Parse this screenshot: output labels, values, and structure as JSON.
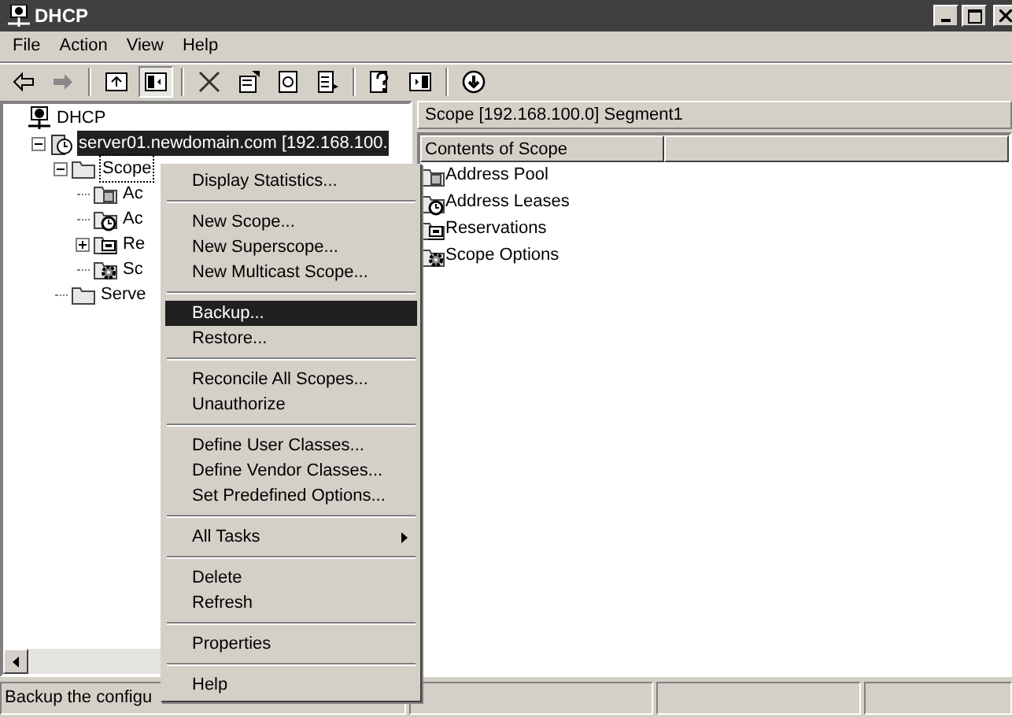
{
  "window": {
    "title": "DHCP"
  },
  "menu_bar": [
    "File",
    "Action",
    "View",
    "Help"
  ],
  "toolbar": [
    {
      "kind": "back",
      "disabled": false
    },
    {
      "kind": "forward",
      "disabled": true
    },
    {
      "kind": "sep"
    },
    {
      "kind": "up",
      "selected": false
    },
    {
      "kind": "tree",
      "selected": true
    },
    {
      "kind": "sep"
    },
    {
      "kind": "delete"
    },
    {
      "kind": "properties"
    },
    {
      "kind": "refresh"
    },
    {
      "kind": "export"
    },
    {
      "kind": "sep"
    },
    {
      "kind": "help"
    },
    {
      "kind": "pane"
    },
    {
      "kind": "sep"
    },
    {
      "kind": "download"
    }
  ],
  "tree": [
    {
      "label": "DHCP",
      "kind": "dhcp",
      "children": [
        {
          "label": "server01.newdomain.com [192.168.100.",
          "kind": "server",
          "expanded": true,
          "selected": true,
          "children": [
            {
              "label": "Scope",
              "kind": "folder",
              "expanded": true,
              "selected": false,
              "children": [
                {
                  "label": "Ac",
                  "kind": "pool",
                  "selected": false
                },
                {
                  "label": "Ac",
                  "kind": "leases",
                  "selected": false
                },
                {
                  "label": "Re",
                  "kind": "reservations",
                  "expanded": false,
                  "selected": false
                },
                {
                  "label": "Sc",
                  "kind": "options",
                  "selected": false
                }
              ]
            },
            {
              "label": "Serve",
              "kind": "folder",
              "selected": false
            }
          ]
        }
      ]
    }
  ],
  "right_pane": {
    "title": "Scope [192.168.100.0] Segment1",
    "columns": [
      "Contents of Scope"
    ],
    "items": [
      {
        "label": "Address Pool",
        "kind": "pool"
      },
      {
        "label": "Address Leases",
        "kind": "leases"
      },
      {
        "label": "Reservations",
        "kind": "reservations"
      },
      {
        "label": "Scope Options",
        "kind": "options"
      }
    ]
  },
  "status_bar": {
    "text": "Backup the configu"
  },
  "context_menu": [
    [
      {
        "label": "Display Statistics...",
        "selected": false
      }
    ],
    [
      {
        "label": "New Scope...",
        "selected": false
      },
      {
        "label": "New Superscope...",
        "selected": false
      },
      {
        "label": "New Multicast Scope...",
        "selected": false
      }
    ],
    [
      {
        "label": "Backup...",
        "selected": true
      },
      {
        "label": "Restore...",
        "selected": false
      }
    ],
    [
      {
        "label": "Reconcile All Scopes...",
        "selected": false
      },
      {
        "label": "Unauthorize",
        "selected": false
      }
    ],
    [
      {
        "label": "Define User Classes...",
        "selected": false
      },
      {
        "label": "Define Vendor Classes...",
        "selected": false
      },
      {
        "label": "Set Predefined Options...",
        "selected": false
      }
    ],
    [
      {
        "label": "All Tasks",
        "selected": false,
        "submenu": true
      }
    ],
    [
      {
        "label": "Delete",
        "selected": false
      },
      {
        "label": "Refresh",
        "selected": false
      }
    ],
    [
      {
        "label": "Properties",
        "selected": false
      }
    ],
    [
      {
        "label": "Help",
        "selected": false
      }
    ]
  ]
}
